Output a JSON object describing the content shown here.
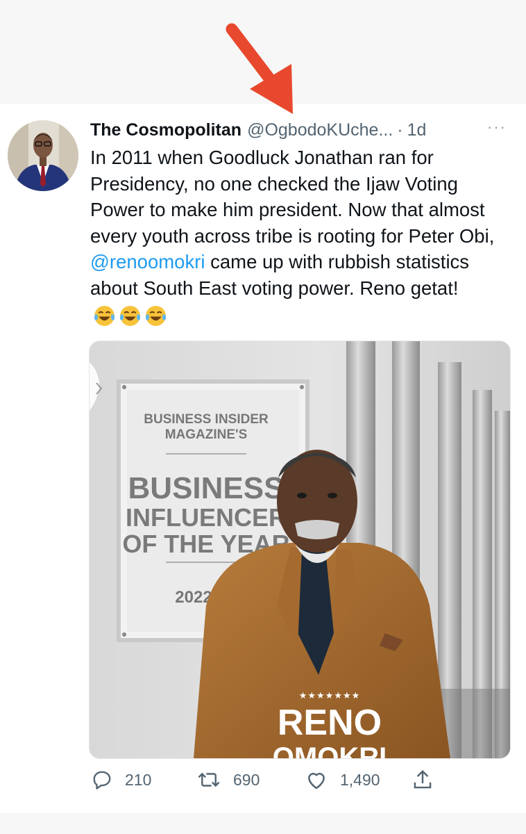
{
  "tweet": {
    "display_name": "The Cosmopolitan",
    "handle": "@OgbodoKUche...",
    "separator": "·",
    "time": "1d",
    "more": "···",
    "text_part1": "In 2011 when Goodluck Jonathan ran for Presidency, no one checked the Ijaw Voting Power to make him president. Now that almost every youth across tribe is rooting for Peter Obi, ",
    "mention": "@renoomokri",
    "text_part2": " came up with rubbish statistics about South East voting power. Reno getat!",
    "emoji_count": 3
  },
  "media": {
    "plaque_line1": "BUSINESS INSIDER",
    "plaque_line2": "MAGAZINE'S",
    "plaque_big1": "BUSINESS",
    "plaque_big2": "INFLUENCER",
    "plaque_big3": "OF THE YEAR",
    "plaque_year": "2022",
    "stars": "★★★★★★★",
    "name_line1": "RENO",
    "name_line2": "OMOKRI"
  },
  "actions": {
    "replies": "210",
    "retweets": "690",
    "likes": "1,490"
  },
  "colors": {
    "accent": "#1d9bf0",
    "arrow": "#e8492e",
    "muted": "#536471"
  }
}
